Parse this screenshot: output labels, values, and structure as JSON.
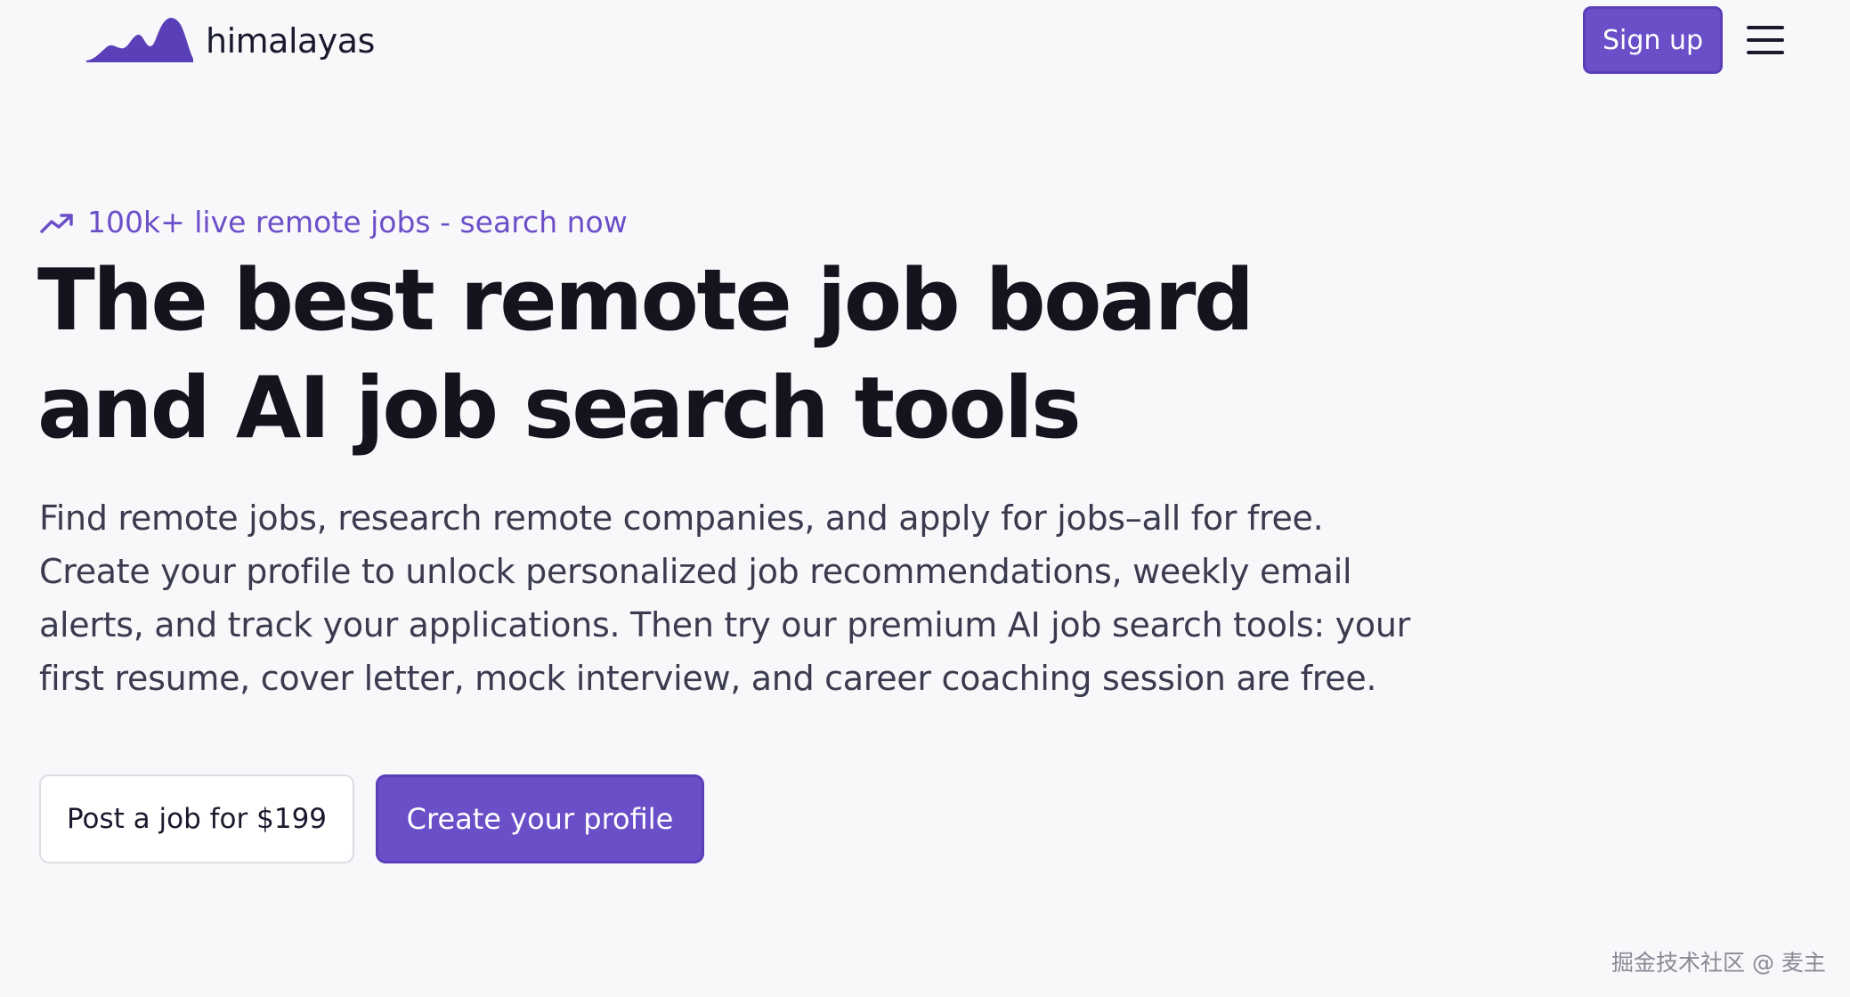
{
  "header": {
    "logo_text": "himalayas",
    "signup_label": "Sign up",
    "menu_icon": "hamburger-menu-icon"
  },
  "hero": {
    "tagline_icon": "trending-up-icon",
    "tagline": "100k+ live remote jobs - search now",
    "headline_lines": [
      "The best remote job board",
      "and AI job search tools"
    ],
    "description_lines": [
      "Find remote jobs, research remote companies, and apply for jobs–all for free.",
      "Create your profile to unlock personalized job recommendations, weekly email",
      "alerts, and track your applications. Then try our premium AI job search tools: your",
      "first resume, cover letter, mock interview, and career coaching session are free."
    ],
    "post_job_label": "Post a job for $199",
    "create_profile_label": "Create your profile"
  },
  "watermark": "掘金技术社区 @ 麦主",
  "colors": {
    "brand": "#6b4fc8",
    "brand_border": "#5a3fb8",
    "text_dark": "#14141f",
    "text_body": "#3b3b4f",
    "background": "#f8f8fb"
  }
}
